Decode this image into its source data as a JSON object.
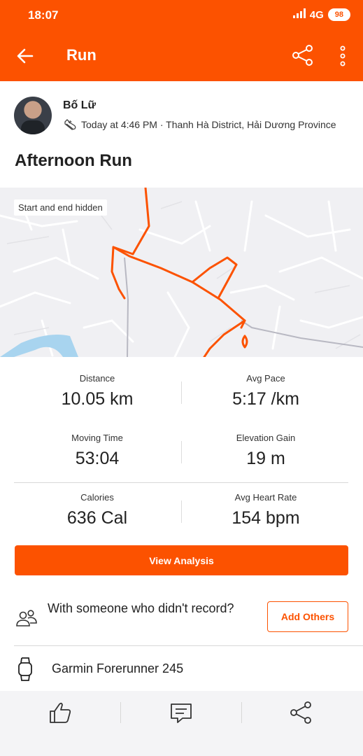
{
  "status_bar": {
    "time": "18:07",
    "network": "4G",
    "battery": "98"
  },
  "header": {
    "title": "Run"
  },
  "athlete": {
    "name": "Bố Lữ",
    "meta": "Today at 4:46 PM · Thanh Hà District, Hải Dương Province"
  },
  "activity": {
    "title": "Afternoon Run"
  },
  "map": {
    "label": "Start and end hidden",
    "route_color": "#fc5200"
  },
  "stats": {
    "distance": {
      "label": "Distance",
      "value": "10.05 km"
    },
    "avg_pace": {
      "label": "Avg Pace",
      "value": "5:17 /km"
    },
    "moving_time": {
      "label": "Moving Time",
      "value": "53:04"
    },
    "elevation": {
      "label": "Elevation Gain",
      "value": "19 m"
    },
    "calories": {
      "label": "Calories",
      "value": "636 Cal"
    },
    "heart_rate": {
      "label": "Avg Heart Rate",
      "value": "154 bpm"
    }
  },
  "actions": {
    "view_analysis": "View Analysis",
    "with_someone": "With someone who didn't record?",
    "add_others": "Add Others"
  },
  "device": {
    "name": "Garmin Forerunner 245"
  },
  "icons": {
    "back": "arrow-left-icon",
    "share": "share-icon",
    "more": "more-vertical-icon",
    "shoe": "shoe-icon",
    "group": "group-icon",
    "watch": "watch-icon",
    "kudos": "thumbs-up-icon",
    "comment": "comment-icon"
  },
  "colors": {
    "brand": "#fc5200"
  }
}
